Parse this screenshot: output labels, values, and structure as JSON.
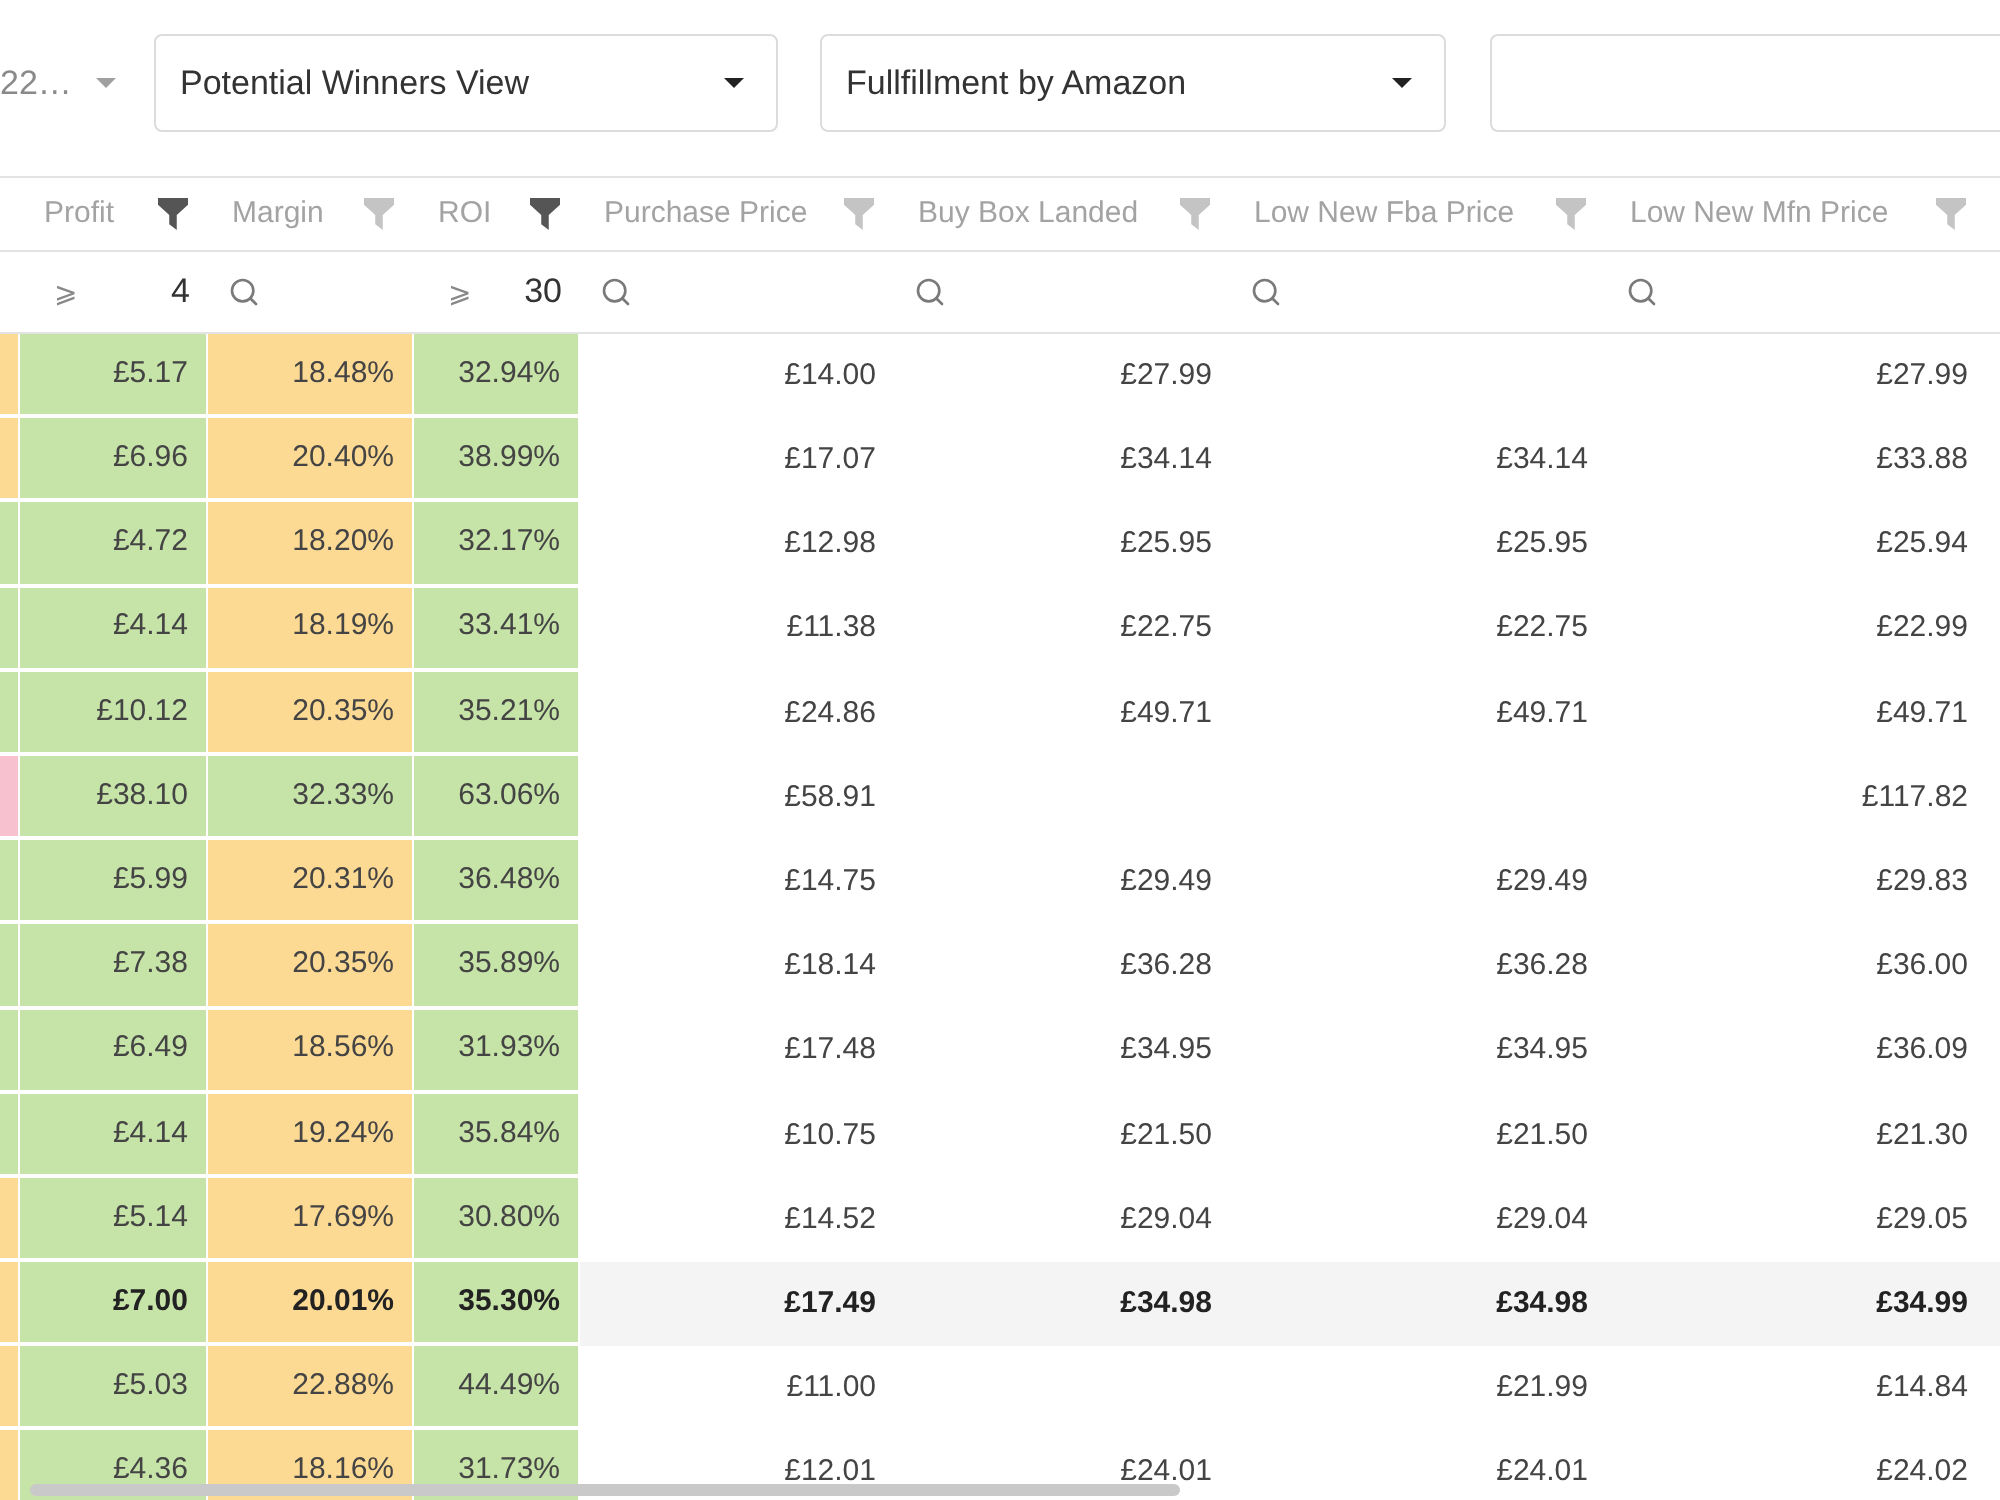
{
  "toolbar": {
    "cut_dropdown": {
      "value": "22…"
    },
    "dropdowns": [
      {
        "value": "Potential Winners View"
      },
      {
        "value": "Fullfillment by Amazon"
      }
    ]
  },
  "table": {
    "columns": [
      {
        "label": "Profit",
        "filtered": true,
        "filter": {
          "kind": "compare",
          "operator": "⩾",
          "value": "4"
        }
      },
      {
        "label": "Margin",
        "filtered": false,
        "filter": {
          "kind": "search"
        }
      },
      {
        "label": "ROI",
        "filtered": true,
        "filter": {
          "kind": "compare",
          "operator": "⩾",
          "value": "30"
        }
      },
      {
        "label": "Purchase Price",
        "filtered": false,
        "filter": {
          "kind": "search"
        }
      },
      {
        "label": "Buy Box Landed",
        "filtered": false,
        "filter": {
          "kind": "search"
        }
      },
      {
        "label": "Low New Fba Price",
        "filtered": false,
        "filter": {
          "kind": "search"
        }
      },
      {
        "label": "Low New Mfn Price",
        "filtered": false,
        "filter": {
          "kind": "search"
        }
      }
    ],
    "rows": [
      {
        "selected": false,
        "edge_cell": {
          "color": "#fdda94"
        },
        "cells": [
          {
            "value": "£5.17",
            "color": "#c6e3a8"
          },
          {
            "value": "18.48%",
            "color": "#fdda94"
          },
          {
            "value": "32.94%",
            "color": "#c6e3a8"
          },
          {
            "value": "£14.00"
          },
          {
            "value": "£27.99"
          },
          null,
          {
            "value": "£27.99"
          }
        ]
      },
      {
        "selected": false,
        "edge_cell": {
          "color": "#fdda94"
        },
        "cells": [
          {
            "value": "£6.96",
            "color": "#c6e3a8"
          },
          {
            "value": "20.40%",
            "color": "#fdda94"
          },
          {
            "value": "38.99%",
            "color": "#c6e3a8"
          },
          {
            "value": "£17.07"
          },
          {
            "value": "£34.14"
          },
          {
            "value": "£34.14"
          },
          {
            "value": "£33.88"
          }
        ]
      },
      {
        "selected": false,
        "edge_cell": {
          "color": "#c6e3a8"
        },
        "cells": [
          {
            "value": "£4.72",
            "color": "#c6e3a8"
          },
          {
            "value": "18.20%",
            "color": "#fdda94"
          },
          {
            "value": "32.17%",
            "color": "#c6e3a8"
          },
          {
            "value": "£12.98"
          },
          {
            "value": "£25.95"
          },
          {
            "value": "£25.95"
          },
          {
            "value": "£25.94"
          }
        ]
      },
      {
        "selected": false,
        "edge_cell": {
          "color": "#c6e3a8"
        },
        "cells": [
          {
            "value": "£4.14",
            "color": "#c6e3a8"
          },
          {
            "value": "18.19%",
            "color": "#fdda94"
          },
          {
            "value": "33.41%",
            "color": "#c6e3a8"
          },
          {
            "value": "£11.38"
          },
          {
            "value": "£22.75"
          },
          {
            "value": "£22.75"
          },
          {
            "value": "£22.99"
          }
        ]
      },
      {
        "selected": false,
        "edge_cell": {
          "color": "#c6e3a8"
        },
        "cells": [
          {
            "value": "£10.12",
            "color": "#c6e3a8"
          },
          {
            "value": "20.35%",
            "color": "#fdda94"
          },
          {
            "value": "35.21%",
            "color": "#c6e3a8"
          },
          {
            "value": "£24.86"
          },
          {
            "value": "£49.71"
          },
          {
            "value": "£49.71"
          },
          {
            "value": "£49.71"
          }
        ]
      },
      {
        "selected": false,
        "edge_cell": {
          "color": "#f7c1cf"
        },
        "cells": [
          {
            "value": "£38.10",
            "color": "#c6e3a8"
          },
          {
            "value": "32.33%",
            "color": "#c6e3a8"
          },
          {
            "value": "63.06%",
            "color": "#c6e3a8"
          },
          {
            "value": "£58.91"
          },
          null,
          null,
          {
            "value": "£117.82"
          }
        ]
      },
      {
        "selected": false,
        "edge_cell": {
          "color": "#c6e3a8"
        },
        "cells": [
          {
            "value": "£5.99",
            "color": "#c6e3a8"
          },
          {
            "value": "20.31%",
            "color": "#fdda94"
          },
          {
            "value": "36.48%",
            "color": "#c6e3a8"
          },
          {
            "value": "£14.75"
          },
          {
            "value": "£29.49"
          },
          {
            "value": "£29.49"
          },
          {
            "value": "£29.83"
          }
        ]
      },
      {
        "selected": false,
        "edge_cell": {
          "color": "#c6e3a8"
        },
        "cells": [
          {
            "value": "£7.38",
            "color": "#c6e3a8"
          },
          {
            "value": "20.35%",
            "color": "#fdda94"
          },
          {
            "value": "35.89%",
            "color": "#c6e3a8"
          },
          {
            "value": "£18.14"
          },
          {
            "value": "£36.28"
          },
          {
            "value": "£36.28"
          },
          {
            "value": "£36.00"
          }
        ]
      },
      {
        "selected": false,
        "edge_cell": {
          "color": "#c6e3a8"
        },
        "cells": [
          {
            "value": "£6.49",
            "color": "#c6e3a8"
          },
          {
            "value": "18.56%",
            "color": "#fdda94"
          },
          {
            "value": "31.93%",
            "color": "#c6e3a8"
          },
          {
            "value": "£17.48"
          },
          {
            "value": "£34.95"
          },
          {
            "value": "£34.95"
          },
          {
            "value": "£36.09"
          }
        ]
      },
      {
        "selected": false,
        "edge_cell": {
          "color": "#c6e3a8"
        },
        "cells": [
          {
            "value": "£4.14",
            "color": "#c6e3a8"
          },
          {
            "value": "19.24%",
            "color": "#fdda94"
          },
          {
            "value": "35.84%",
            "color": "#c6e3a8"
          },
          {
            "value": "£10.75"
          },
          {
            "value": "£21.50"
          },
          {
            "value": "£21.50"
          },
          {
            "value": "£21.30"
          }
        ]
      },
      {
        "selected": false,
        "edge_cell": {
          "color": "#fdda94"
        },
        "cells": [
          {
            "value": "£5.14",
            "color": "#c6e3a8"
          },
          {
            "value": "17.69%",
            "color": "#fdda94"
          },
          {
            "value": "30.80%",
            "color": "#c6e3a8"
          },
          {
            "value": "£14.52"
          },
          {
            "value": "£29.04"
          },
          {
            "value": "£29.04"
          },
          {
            "value": "£29.05"
          }
        ]
      },
      {
        "selected": true,
        "edge_cell": {
          "color": "#fdda94"
        },
        "cells": [
          {
            "value": "£7.00",
            "color": "#c6e3a8"
          },
          {
            "value": "20.01%",
            "color": "#fdda94"
          },
          {
            "value": "35.30%",
            "color": "#c6e3a8"
          },
          {
            "value": "£17.49"
          },
          {
            "value": "£34.98"
          },
          {
            "value": "£34.98"
          },
          {
            "value": "£34.99"
          }
        ]
      },
      {
        "selected": false,
        "edge_cell": {
          "color": "#fdda94"
        },
        "cells": [
          {
            "value": "£5.03",
            "color": "#c6e3a8"
          },
          {
            "value": "22.88%",
            "color": "#fdda94"
          },
          {
            "value": "44.49%",
            "color": "#c6e3a8"
          },
          {
            "value": "£11.00"
          },
          null,
          {
            "value": "£21.99"
          },
          {
            "value": "£14.84"
          }
        ]
      },
      {
        "selected": false,
        "edge_cell": {
          "color": "#fdda94"
        },
        "cells": [
          {
            "value": "£4.36",
            "color": "#c6e3a8"
          },
          {
            "value": "18.16%",
            "color": "#fdda94"
          },
          {
            "value": "31.73%",
            "color": "#c6e3a8"
          },
          {
            "value": "£12.01"
          },
          {
            "value": "£24.01"
          },
          {
            "value": "£24.01"
          },
          {
            "value": "£24.02"
          }
        ]
      }
    ]
  }
}
